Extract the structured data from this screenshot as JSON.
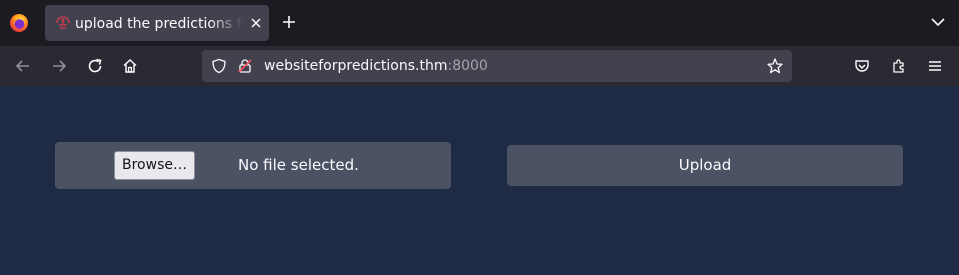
{
  "browser": {
    "tab": {
      "title": "upload the predictions file"
    },
    "url": {
      "host": "websiteforpredictions.thm",
      "port": ":8000"
    }
  },
  "page": {
    "browse_label": "Browse…",
    "file_status": "No file selected.",
    "upload_label": "Upload"
  },
  "colors": {
    "background": "#1f2a44",
    "panel": "#4a5263",
    "tabbar": "#1c1b22",
    "navbar": "#2b2a33",
    "favicon": "#c13b4f"
  }
}
